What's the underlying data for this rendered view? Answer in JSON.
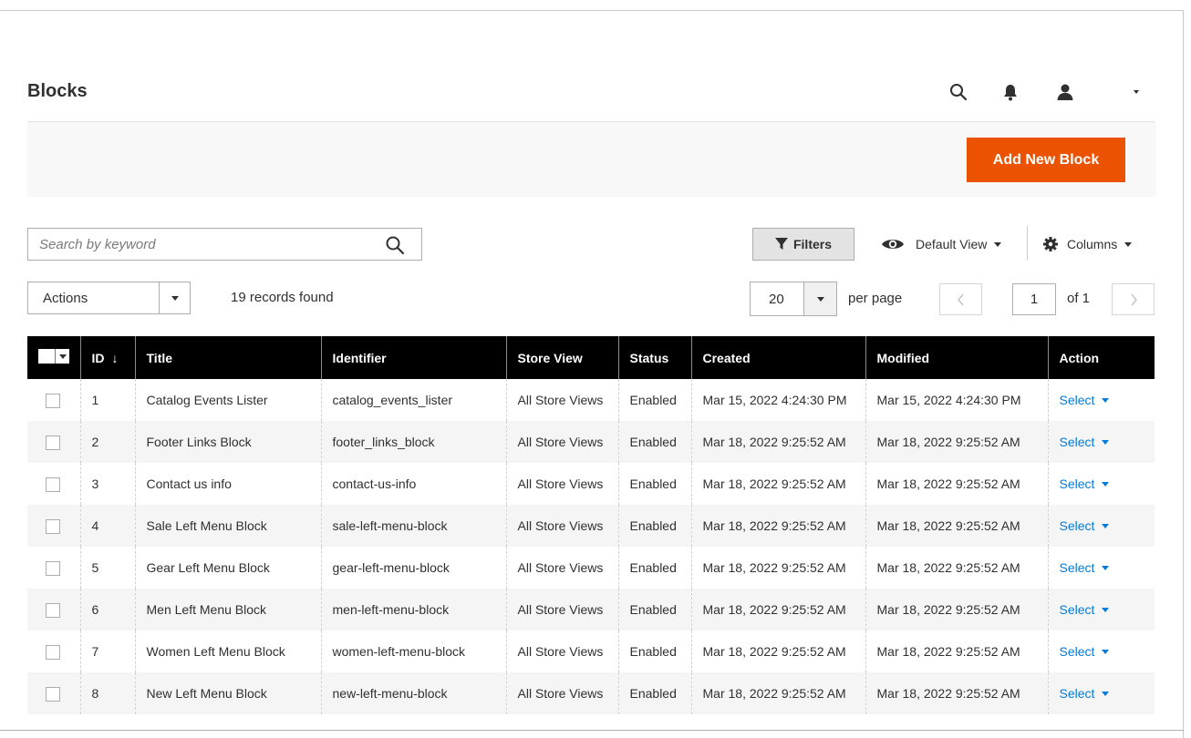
{
  "header": {
    "title": "Blocks",
    "icons": [
      "search-icon",
      "bell-icon",
      "user-icon",
      "chevron-down-icon"
    ]
  },
  "page_actions": {
    "add_label": "Add New Block"
  },
  "toolbar": {
    "search_placeholder": "Search by keyword",
    "filters_label": "Filters",
    "view_label": "Default View",
    "columns_label": "Columns",
    "mass_actions_label": "Actions",
    "records_found": "19 records found",
    "per_page_value": "20",
    "per_page_label": "per page",
    "current_page": "1",
    "of_pages": "of 1"
  },
  "grid": {
    "columns": [
      "ID",
      "Title",
      "Identifier",
      "Store View",
      "Status",
      "Created",
      "Modified",
      "Action"
    ],
    "sort_indicator": "↓",
    "action_label": "Select",
    "rows": [
      {
        "id": "1",
        "title": "Catalog Events Lister",
        "identifier": "catalog_events_lister",
        "store_view": "All Store Views",
        "status": "Enabled",
        "created": "Mar 15, 2022 4:24:30 PM",
        "modified": "Mar 15, 2022 4:24:30 PM"
      },
      {
        "id": "2",
        "title": "Footer Links Block",
        "identifier": "footer_links_block",
        "store_view": "All Store Views",
        "status": "Enabled",
        "created": "Mar 18, 2022 9:25:52 AM",
        "modified": "Mar 18, 2022 9:25:52 AM"
      },
      {
        "id": "3",
        "title": "Contact us info",
        "identifier": "contact-us-info",
        "store_view": "All Store Views",
        "status": "Enabled",
        "created": "Mar 18, 2022 9:25:52 AM",
        "modified": "Mar 18, 2022 9:25:52 AM"
      },
      {
        "id": "4",
        "title": "Sale Left Menu Block",
        "identifier": "sale-left-menu-block",
        "store_view": "All Store Views",
        "status": "Enabled",
        "created": "Mar 18, 2022 9:25:52 AM",
        "modified": "Mar 18, 2022 9:25:52 AM"
      },
      {
        "id": "5",
        "title": "Gear Left Menu Block",
        "identifier": "gear-left-menu-block",
        "store_view": "All Store Views",
        "status": "Enabled",
        "created": "Mar 18, 2022 9:25:52 AM",
        "modified": "Mar 18, 2022 9:25:52 AM"
      },
      {
        "id": "6",
        "title": "Men Left Menu Block",
        "identifier": "men-left-menu-block",
        "store_view": "All Store Views",
        "status": "Enabled",
        "created": "Mar 18, 2022 9:25:52 AM",
        "modified": "Mar 18, 2022 9:25:52 AM"
      },
      {
        "id": "7",
        "title": "Women Left Menu Block",
        "identifier": "women-left-menu-block",
        "store_view": "All Store Views",
        "status": "Enabled",
        "created": "Mar 18, 2022 9:25:52 AM",
        "modified": "Mar 18, 2022 9:25:52 AM"
      },
      {
        "id": "8",
        "title": "New Left Menu Block",
        "identifier": "new-left-menu-block",
        "store_view": "All Store Views",
        "status": "Enabled",
        "created": "Mar 18, 2022 9:25:52 AM",
        "modified": "Mar 18, 2022 9:25:52 AM"
      }
    ]
  },
  "colors": {
    "accent": "#eb5202",
    "link": "#007bdb",
    "grid_header": "#000000"
  }
}
